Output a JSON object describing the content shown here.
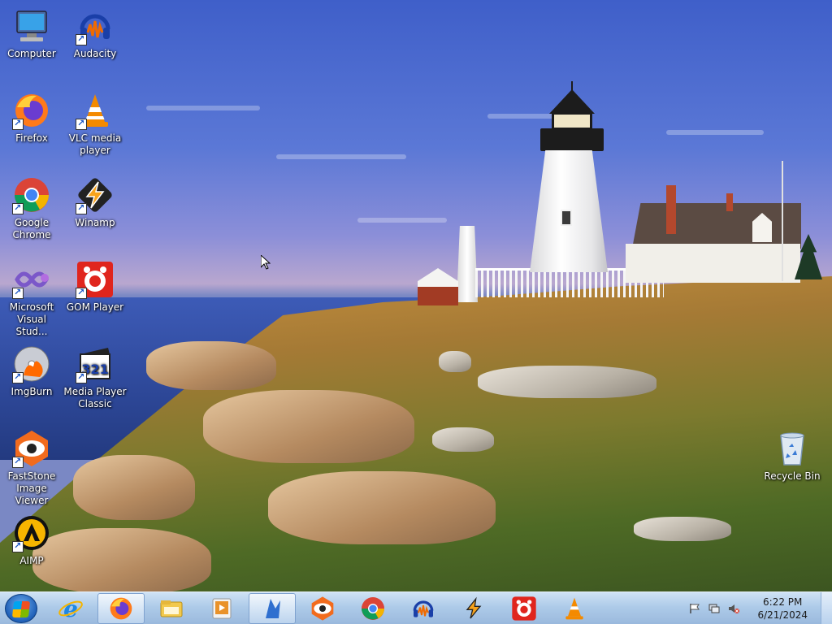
{
  "desktop": {
    "icons": [
      {
        "label": "Computer",
        "icon": "computer-icon"
      },
      {
        "label": "Audacity",
        "icon": "audacity-icon"
      },
      {
        "label": "Firefox",
        "icon": "firefox-icon"
      },
      {
        "label": "VLC media player",
        "icon": "vlc-icon"
      },
      {
        "label": "Google Chrome",
        "icon": "chrome-icon"
      },
      {
        "label": "Winamp",
        "icon": "winamp-icon"
      },
      {
        "label": "Microsoft Visual Stud...",
        "icon": "visual-studio-icon"
      },
      {
        "label": "GOM Player",
        "icon": "gom-player-icon"
      },
      {
        "label": "ImgBurn",
        "icon": "imgburn-icon"
      },
      {
        "label": "Media Player Classic",
        "icon": "media-player-classic-icon"
      },
      {
        "label": "FastStone Image Viewer",
        "icon": "faststone-icon"
      },
      {
        "label": "AIMP",
        "icon": "aimp-icon"
      },
      {
        "label": "Recycle Bin",
        "icon": "recycle-bin-icon"
      }
    ]
  },
  "taskbar": {
    "pinned": [
      {
        "name": "internet-explorer-icon"
      },
      {
        "name": "firefox-icon",
        "active": true
      },
      {
        "name": "file-explorer-icon"
      },
      {
        "name": "media-player-icon"
      },
      {
        "name": "visual-studio-icon",
        "active": true
      },
      {
        "name": "faststone-icon"
      },
      {
        "name": "chrome-icon"
      },
      {
        "name": "audacity-icon"
      },
      {
        "name": "winamp-icon"
      },
      {
        "name": "gom-player-icon"
      },
      {
        "name": "vlc-icon"
      }
    ],
    "clock": {
      "time": "6:22 PM",
      "date": "6/21/2024"
    }
  }
}
